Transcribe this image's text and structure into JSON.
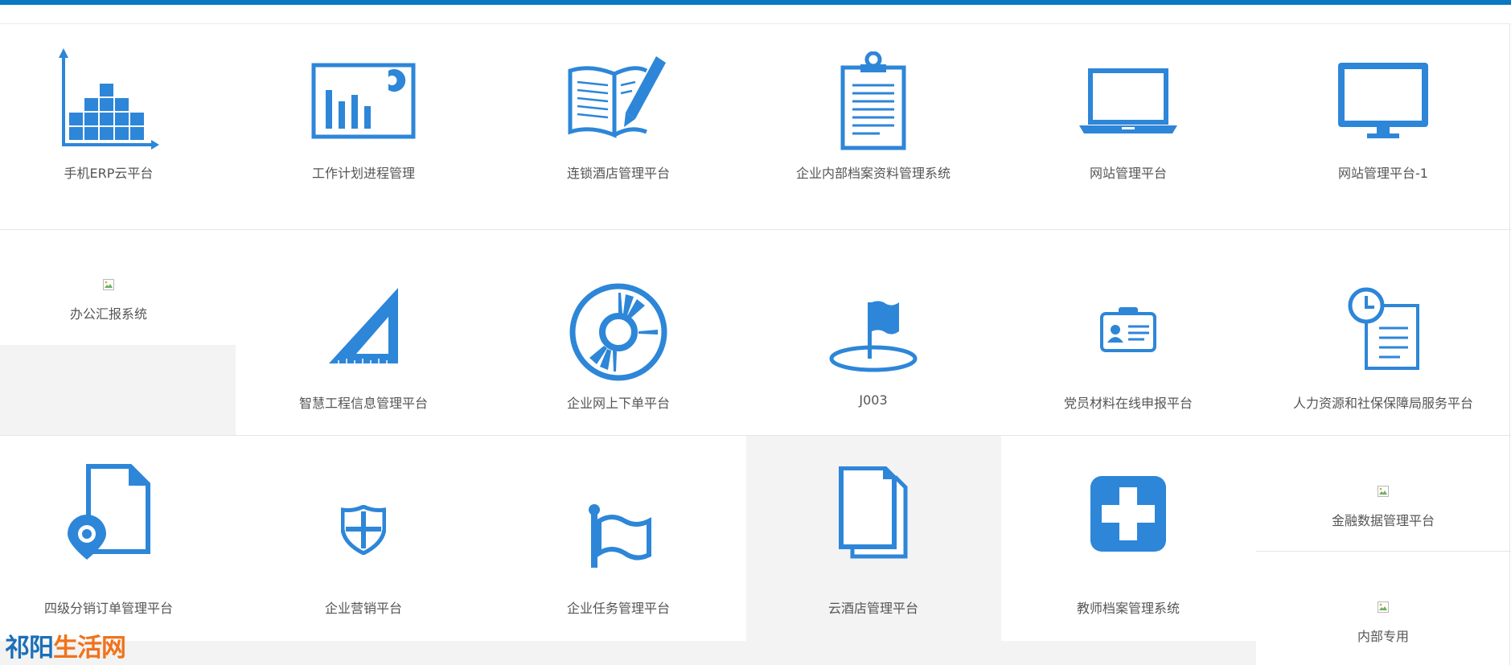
{
  "colors": {
    "accent": "#0a78c2",
    "icon": "#2d86d8",
    "label": "#555555",
    "gray_cell": "#f3f3f3"
  },
  "apps": [
    {
      "label": "手机ERP云平台",
      "icon": "bar-chart-icon"
    },
    {
      "label": "工作计划进程管理",
      "icon": "presentation-chart-icon"
    },
    {
      "label": "连锁酒店管理平台",
      "icon": "book-pencil-icon"
    },
    {
      "label": "企业内部档案资料管理系统",
      "icon": "clipboard-icon"
    },
    {
      "label": "网站管理平台",
      "icon": "laptop-icon"
    },
    {
      "label": "网站管理平台-1",
      "icon": "monitor-icon"
    },
    {
      "label": "办公汇报系统",
      "icon": "broken-image-icon"
    },
    {
      "label": "智慧工程信息管理平台",
      "icon": "set-square-icon"
    },
    {
      "label": "企业网上下单平台",
      "icon": "disc-icon"
    },
    {
      "label": "J003",
      "icon": "flag-target-icon"
    },
    {
      "label": "党员材料在线申报平台",
      "icon": "id-card-icon"
    },
    {
      "label": "人力资源和社保保障局服务平台",
      "icon": "clock-document-icon"
    },
    {
      "label": "四级分销订单管理平台",
      "icon": "file-location-icon"
    },
    {
      "label": "企业营销平台",
      "icon": "shield-icon"
    },
    {
      "label": "企业任务管理平台",
      "icon": "flag-icon"
    },
    {
      "label": "云酒店管理平台",
      "icon": "documents-icon"
    },
    {
      "label": "教师档案管理系统",
      "icon": "medical-cross-icon"
    },
    {
      "label": "金融数据管理平台",
      "icon": "broken-image-icon"
    },
    {
      "label": "内部专用",
      "icon": "broken-image-icon"
    }
  ],
  "watermark": {
    "part1": "祁阳",
    "part2": "生活网"
  }
}
